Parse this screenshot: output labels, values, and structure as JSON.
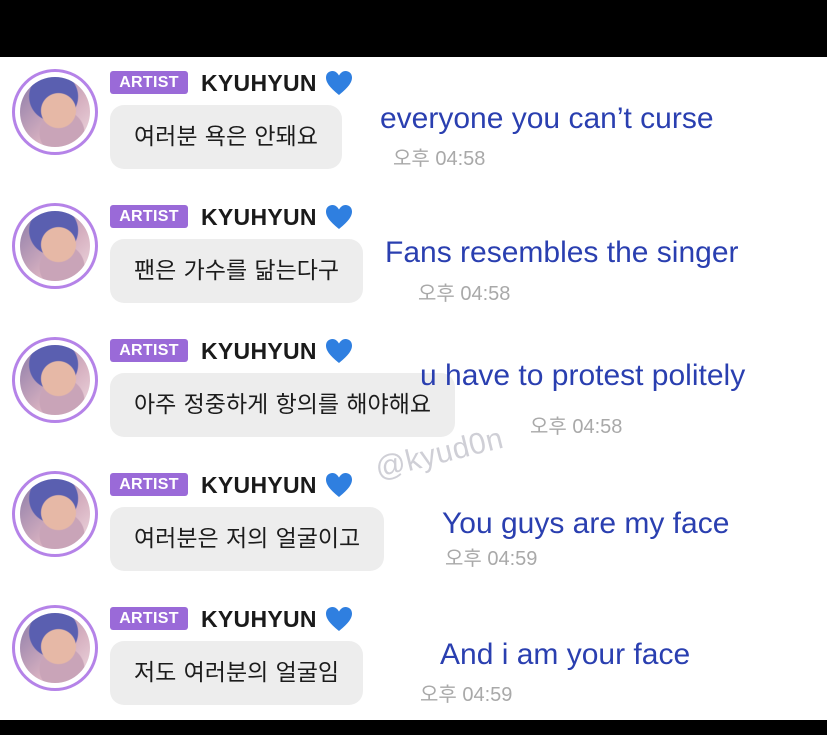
{
  "messages": [
    {
      "badge": "ARTIST",
      "name": "KYUHYUN",
      "text": "여러분 욕은 안돼요",
      "time": "오후 04:58",
      "translation": "everyone you can’t curse"
    },
    {
      "badge": "ARTIST",
      "name": "KYUHYUN",
      "text": "팬은 가수를 닮는다구",
      "time": "오후 04:58",
      "translation": "Fans resembles the singer"
    },
    {
      "badge": "ARTIST",
      "name": "KYUHYUN",
      "text": "아주 정중하게 항의를 해야해요",
      "time": "오후 04:58",
      "translation": "u have to protest politely"
    },
    {
      "badge": "ARTIST",
      "name": "KYUHYUN",
      "text": "여러분은 저의 얼굴이고",
      "time": "오후 04:59",
      "translation": "You guys are my face"
    },
    {
      "badge": "ARTIST",
      "name": "KYUHYUN",
      "text": "저도 여러분의 얼굴임",
      "time": "오후 04:59",
      "translation": "And i am your face"
    }
  ],
  "watermark": "@kyud0n",
  "colors": {
    "badge": "#9a6ad8",
    "heart": "#2f7fe0",
    "translation": "#2a3fb0",
    "bubble": "#ededed",
    "time": "#a9a9a9"
  },
  "icons": {
    "heart": "blue-heart-icon"
  }
}
